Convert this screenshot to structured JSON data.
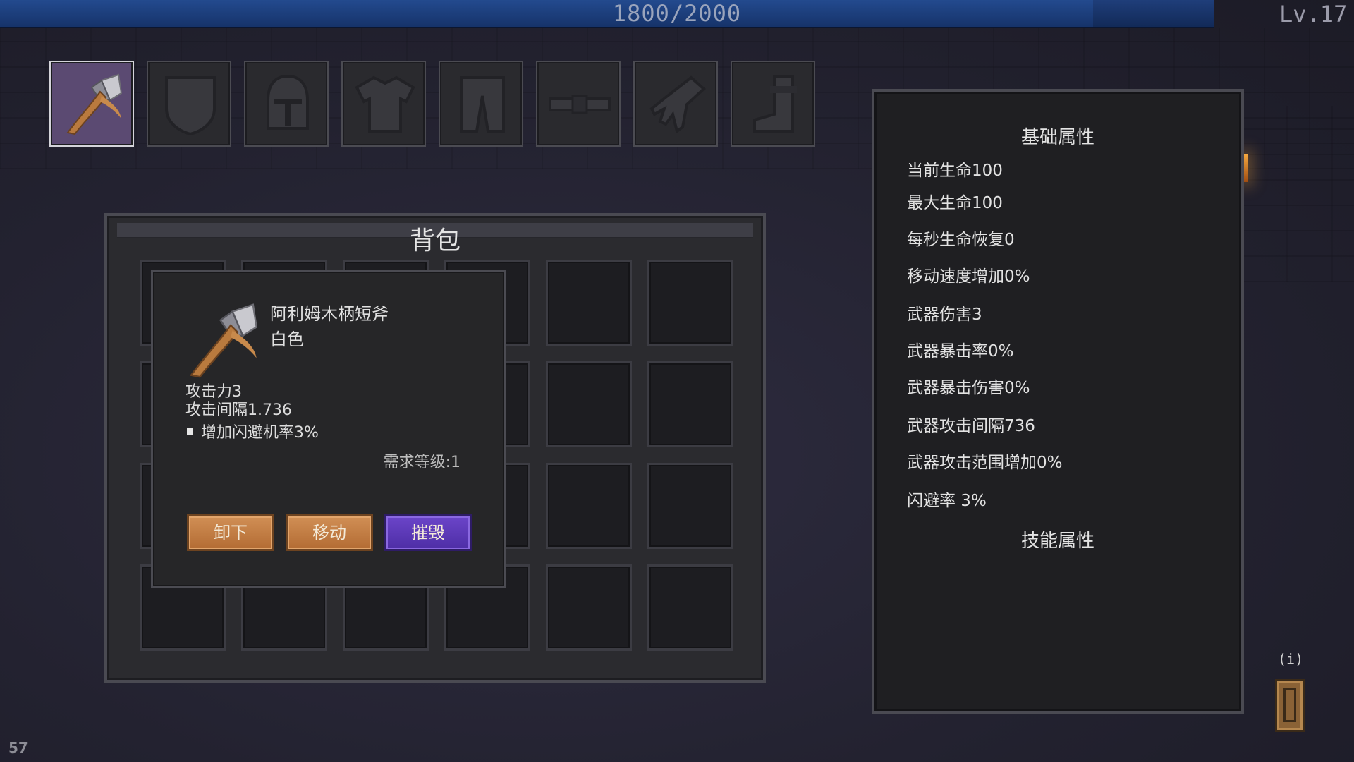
{
  "hud": {
    "xp_text": "1800/2000",
    "xp_progress": 0.9,
    "level_text": "Lv.17",
    "fps": "57"
  },
  "equipment": {
    "slots": [
      {
        "name": "weapon",
        "icon": "axe-icon",
        "active": true
      },
      {
        "name": "shield",
        "icon": "shield-icon",
        "active": false
      },
      {
        "name": "helmet",
        "icon": "helmet-icon",
        "active": false
      },
      {
        "name": "armor",
        "icon": "armor-icon",
        "active": false
      },
      {
        "name": "pants",
        "icon": "pants-icon",
        "active": false
      },
      {
        "name": "belt",
        "icon": "belt-icon",
        "active": false
      },
      {
        "name": "gloves",
        "icon": "glove-icon",
        "active": false
      },
      {
        "name": "boots",
        "icon": "boot-icon",
        "active": false
      }
    ]
  },
  "bag": {
    "title": "背包"
  },
  "tooltip": {
    "item_name": "阿利姆木柄短斧",
    "rarity": "白色",
    "attack": "攻击力3",
    "attack_interval": "攻击间隔1.736",
    "bonus": "增加闪避机率3%",
    "required_level": "需求等级:1",
    "buttons": {
      "unequip": "卸下",
      "move": "移动",
      "destroy": "摧毁"
    }
  },
  "stats": {
    "base_title": "基础属性",
    "items": [
      "当前生命100",
      "最大生命100",
      "每秒生命恢复0",
      "移动速度增加0%",
      "武器伤害3",
      "武器暴击率0%",
      "武器暴击伤害0%",
      "武器攻击间隔736",
      "武器攻击范围增加0%",
      "闪避率 3%"
    ],
    "skill_title": "技能属性"
  },
  "info_button": {
    "label": "(i)"
  },
  "colors": {
    "accent_purple": "#5b4a72",
    "button_brown": "#c47e45",
    "button_purple": "#5a38b8",
    "xp_blue": "#1f3e7a"
  }
}
